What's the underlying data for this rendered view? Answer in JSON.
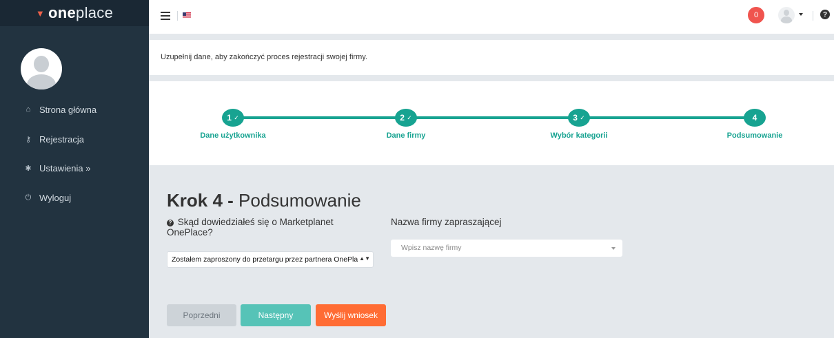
{
  "brand": {
    "mark": "▼",
    "name_bold": "one",
    "name_light": "place"
  },
  "sidebar": {
    "items": [
      {
        "icon": "home-icon",
        "glyph": "⌂",
        "label": "Strona główna"
      },
      {
        "icon": "key-icon",
        "glyph": "⚷",
        "label": "Rejestracja"
      },
      {
        "icon": "gear-icon",
        "glyph": "✱",
        "label": "Ustawienia »"
      },
      {
        "icon": "power-icon",
        "glyph": "⏻",
        "label": "Wyloguj"
      }
    ]
  },
  "topbar": {
    "notifications": "0",
    "help": "?"
  },
  "message": "Uzupełnij dane, aby zakończyć proces rejestracji swojej firmy.",
  "steps": [
    {
      "num": "1",
      "check": "✓",
      "label": "Dane użytkownika",
      "done": true
    },
    {
      "num": "2",
      "check": "✓",
      "label": "Dane firmy",
      "done": true
    },
    {
      "num": "3",
      "check": "✓",
      "label": "Wybór kategorii",
      "done": true
    },
    {
      "num": "4",
      "check": "",
      "label": "Podsumowanie",
      "done": false
    }
  ],
  "form": {
    "title_step": "Krok 4 - ",
    "title_name": "Podsumowanie",
    "question_icon": "?",
    "question_label": "Skąd dowiedziałeś się o Marketplanet OnePlace?",
    "question_value": "Zostałem zaproszony do przetargu przez partnera OnePlace",
    "company_label": "Nazwa firmy zapraszającej",
    "company_placeholder": "Wpisz nazwę firmy"
  },
  "buttons": {
    "prev": "Poprzedni",
    "next": "Następny",
    "send": "Wyślij wniosek"
  },
  "colors": {
    "sidebar": "#223340",
    "teal": "#17a391",
    "orange": "#ff6c34",
    "badge": "#f0544e"
  }
}
